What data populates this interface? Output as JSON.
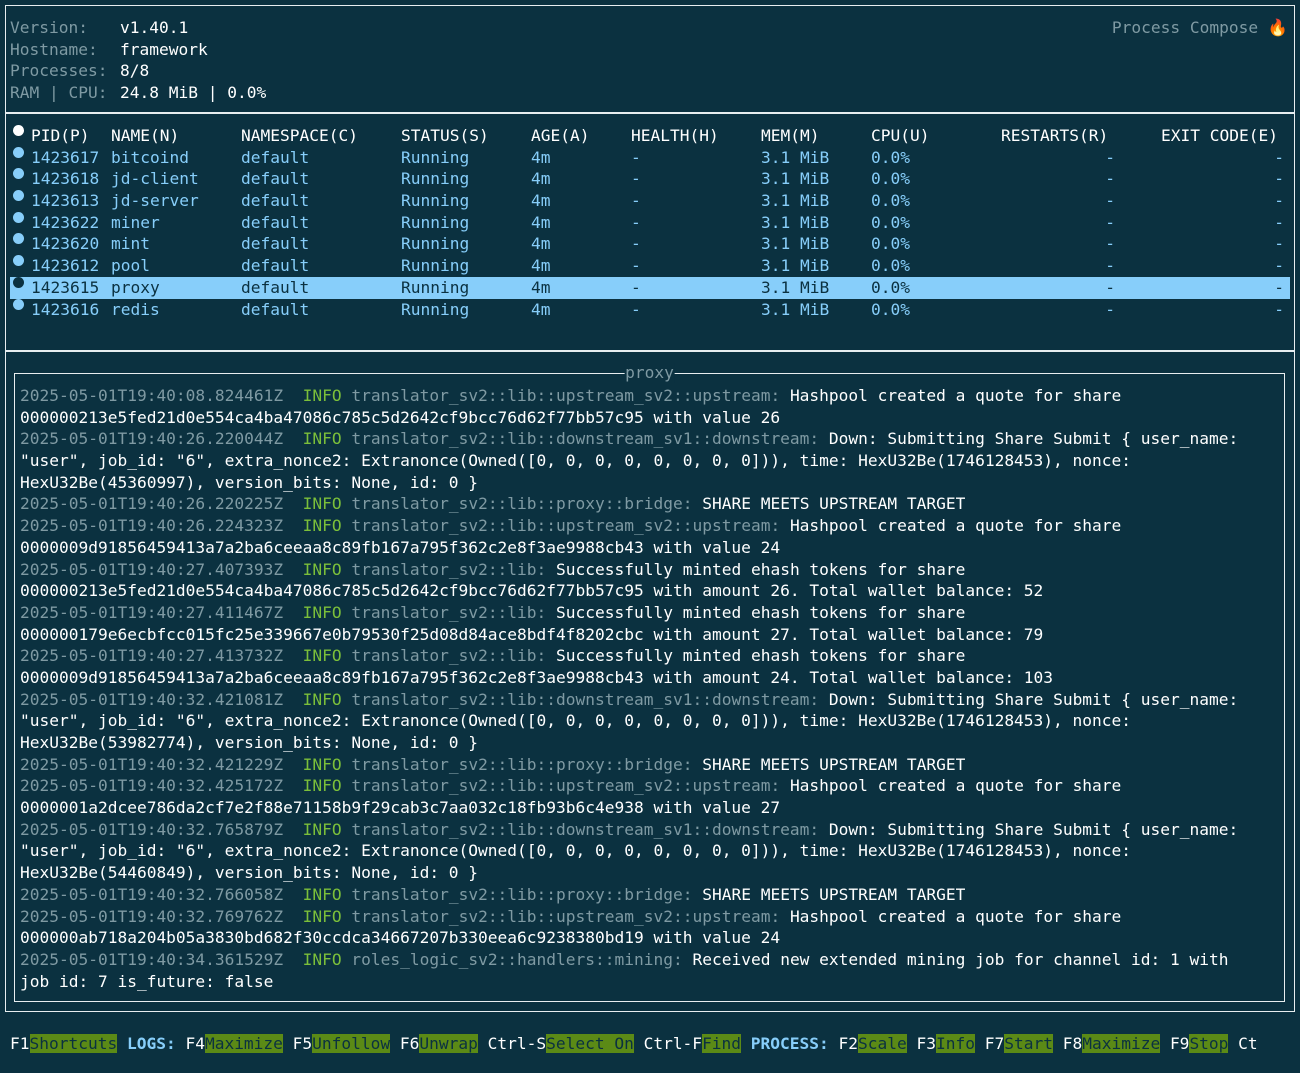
{
  "info": {
    "version_label": "Version:",
    "version": "v1.40.1",
    "hostname_label": "Hostname:",
    "hostname": "framework",
    "processes_label": "Processes:",
    "processes": "8/8",
    "ram_cpu_label": "RAM | CPU:",
    "ram_cpu": "24.8 MiB | 0.0%",
    "brand": "Process Compose",
    "brand_icon": "flame-icon"
  },
  "table": {
    "headers": {
      "pid": "PID(P)",
      "name": "NAME(N)",
      "namespace": "NAMESPACE(C)",
      "status": "STATUS(S)",
      "age": "AGE(A)",
      "health": "HEALTH(H)",
      "mem": "MEM(M)",
      "cpu": "CPU(U)",
      "restarts": "RESTARTS(R)",
      "exit": "EXIT CODE(E)"
    },
    "rows": [
      {
        "pid": "1423617",
        "name": "bitcoind",
        "namespace": "default",
        "status": "Running",
        "age": "4m",
        "health": "-",
        "mem": "3.1 MiB",
        "cpu": "0.0%",
        "restarts": "-",
        "exit": "-"
      },
      {
        "pid": "1423618",
        "name": "jd-client",
        "namespace": "default",
        "status": "Running",
        "age": "4m",
        "health": "-",
        "mem": "3.1 MiB",
        "cpu": "0.0%",
        "restarts": "-",
        "exit": "-"
      },
      {
        "pid": "1423613",
        "name": "jd-server",
        "namespace": "default",
        "status": "Running",
        "age": "4m",
        "health": "-",
        "mem": "3.1 MiB",
        "cpu": "0.0%",
        "restarts": "-",
        "exit": "-"
      },
      {
        "pid": "1423622",
        "name": "miner",
        "namespace": "default",
        "status": "Running",
        "age": "4m",
        "health": "-",
        "mem": "3.1 MiB",
        "cpu": "0.0%",
        "restarts": "-",
        "exit": "-"
      },
      {
        "pid": "1423620",
        "name": "mint",
        "namespace": "default",
        "status": "Running",
        "age": "4m",
        "health": "-",
        "mem": "3.1 MiB",
        "cpu": "0.0%",
        "restarts": "-",
        "exit": "-"
      },
      {
        "pid": "1423612",
        "name": "pool",
        "namespace": "default",
        "status": "Running",
        "age": "4m",
        "health": "-",
        "mem": "3.1 MiB",
        "cpu": "0.0%",
        "restarts": "-",
        "exit": "-"
      },
      {
        "pid": "1423615",
        "name": "proxy",
        "namespace": "default",
        "status": "Running",
        "age": "4m",
        "health": "-",
        "mem": "3.1 MiB",
        "cpu": "0.0%",
        "restarts": "-",
        "exit": "-"
      },
      {
        "pid": "1423616",
        "name": "redis",
        "namespace": "default",
        "status": "Running",
        "age": "4m",
        "health": "-",
        "mem": "3.1 MiB",
        "cpu": "0.0%",
        "restarts": "-",
        "exit": "-"
      }
    ]
  },
  "log": {
    "title": "proxy",
    "lines": [
      {
        "ts": "2025-05-01T19:40:08.824461Z",
        "lvl": "INFO",
        "mod": "translator_sv2::lib::upstream_sv2::upstream:",
        "msg": "Hashpool created a quote for share"
      },
      {
        "msg": "000000213e5fed21d0e554ca4ba47086c785c5d2642cf9bcc76d62f77bb57c95 with value 26"
      },
      {
        "ts": "2025-05-01T19:40:26.220044Z",
        "lvl": "INFO",
        "mod": "translator_sv2::lib::downstream_sv1::downstream:",
        "msg": "Down: Submitting Share Submit { user_name:"
      },
      {
        "msg": "\"user\", job_id: \"6\", extra_nonce2: Extranonce(Owned([0, 0, 0, 0, 0, 0, 0, 0])), time: HexU32Be(1746128453), nonce:"
      },
      {
        "msg": "HexU32Be(45360997), version_bits: None, id: 0 }"
      },
      {
        "ts": "2025-05-01T19:40:26.220225Z",
        "lvl": "INFO",
        "mod": "translator_sv2::lib::proxy::bridge:",
        "msg": "SHARE MEETS UPSTREAM TARGET"
      },
      {
        "ts": "2025-05-01T19:40:26.224323Z",
        "lvl": "INFO",
        "mod": "translator_sv2::lib::upstream_sv2::upstream:",
        "msg": "Hashpool created a quote for share"
      },
      {
        "msg": "0000009d91856459413a7a2ba6ceeaa8c89fb167a795f362c2e8f3ae9988cb43 with value 24"
      },
      {
        "ts": "2025-05-01T19:40:27.407393Z",
        "lvl": "INFO",
        "mod": "translator_sv2::lib:",
        "msg": "Successfully minted ehash tokens for share"
      },
      {
        "msg": "000000213e5fed21d0e554ca4ba47086c785c5d2642cf9bcc76d62f77bb57c95 with amount 26. Total wallet balance: 52"
      },
      {
        "ts": "2025-05-01T19:40:27.411467Z",
        "lvl": "INFO",
        "mod": "translator_sv2::lib:",
        "msg": "Successfully minted ehash tokens for share"
      },
      {
        "msg": "000000179e6ecbfcc015fc25e339667e0b79530f25d08d84ace8bdf4f8202cbc with amount 27. Total wallet balance: 79"
      },
      {
        "ts": "2025-05-01T19:40:27.413732Z",
        "lvl": "INFO",
        "mod": "translator_sv2::lib:",
        "msg": "Successfully minted ehash tokens for share"
      },
      {
        "msg": "0000009d91856459413a7a2ba6ceeaa8c89fb167a795f362c2e8f3ae9988cb43 with amount 24. Total wallet balance: 103"
      },
      {
        "ts": "2025-05-01T19:40:32.421081Z",
        "lvl": "INFO",
        "mod": "translator_sv2::lib::downstream_sv1::downstream:",
        "msg": "Down: Submitting Share Submit { user_name:"
      },
      {
        "msg": "\"user\", job_id: \"6\", extra_nonce2: Extranonce(Owned([0, 0, 0, 0, 0, 0, 0, 0])), time: HexU32Be(1746128453), nonce:"
      },
      {
        "msg": "HexU32Be(53982774), version_bits: None, id: 0 }"
      },
      {
        "ts": "2025-05-01T19:40:32.421229Z",
        "lvl": "INFO",
        "mod": "translator_sv2::lib::proxy::bridge:",
        "msg": "SHARE MEETS UPSTREAM TARGET"
      },
      {
        "ts": "2025-05-01T19:40:32.425172Z",
        "lvl": "INFO",
        "mod": "translator_sv2::lib::upstream_sv2::upstream:",
        "msg": "Hashpool created a quote for share"
      },
      {
        "msg": "0000001a2dcee786da2cf7e2f88e71158b9f29cab3c7aa032c18fb93b6c4e938 with value 27"
      },
      {
        "ts": "2025-05-01T19:40:32.765879Z",
        "lvl": "INFO",
        "mod": "translator_sv2::lib::downstream_sv1::downstream:",
        "msg": "Down: Submitting Share Submit { user_name:"
      },
      {
        "msg": "\"user\", job_id: \"6\", extra_nonce2: Extranonce(Owned([0, 0, 0, 0, 0, 0, 0, 0])), time: HexU32Be(1746128453), nonce:"
      },
      {
        "msg": "HexU32Be(54460849), version_bits: None, id: 0 }"
      },
      {
        "ts": "2025-05-01T19:40:32.766058Z",
        "lvl": "INFO",
        "mod": "translator_sv2::lib::proxy::bridge:",
        "msg": "SHARE MEETS UPSTREAM TARGET"
      },
      {
        "ts": "2025-05-01T19:40:32.769762Z",
        "lvl": "INFO",
        "mod": "translator_sv2::lib::upstream_sv2::upstream:",
        "msg": "Hashpool created a quote for share"
      },
      {
        "msg": "000000ab718a204b05a3830bd682f30ccdca34667207b330eea6c9238380bd19 with value 24"
      },
      {
        "ts": "2025-05-01T19:40:34.361529Z",
        "lvl": "INFO",
        "mod": "roles_logic_sv2::handlers::mining:",
        "msg": "Received new extended mining job for channel id: 1 with"
      },
      {
        "msg": "job id: 7 is_future: false"
      }
    ]
  },
  "footer": {
    "items": [
      {
        "key": "F1",
        "action": "Shortcuts"
      },
      {
        "section": "LOGS:"
      },
      {
        "key": "F4",
        "action": "Maximize"
      },
      {
        "key": "F5",
        "action": "Unfollow"
      },
      {
        "key": "F6",
        "action": "Unwrap"
      },
      {
        "key": "Ctrl-S",
        "action": "Select On"
      },
      {
        "key": "Ctrl-F",
        "action": "Find"
      },
      {
        "section": "PROCESS:"
      },
      {
        "key": "F2",
        "action": "Scale"
      },
      {
        "key": "F3",
        "action": "Info"
      },
      {
        "key": "F7",
        "action": "Start"
      },
      {
        "key": "F8",
        "action": "Maximize"
      },
      {
        "key": "F9",
        "action": "Stop"
      },
      {
        "key": "Ct",
        "action": ""
      }
    ]
  },
  "colors": {
    "background": "#0b3140",
    "accent_blue": "#87cefa",
    "info_green": "#7bbf3a",
    "key_highlight": "#5b8a16",
    "dim_text": "#7f9aa3"
  },
  "selected_process": "proxy"
}
